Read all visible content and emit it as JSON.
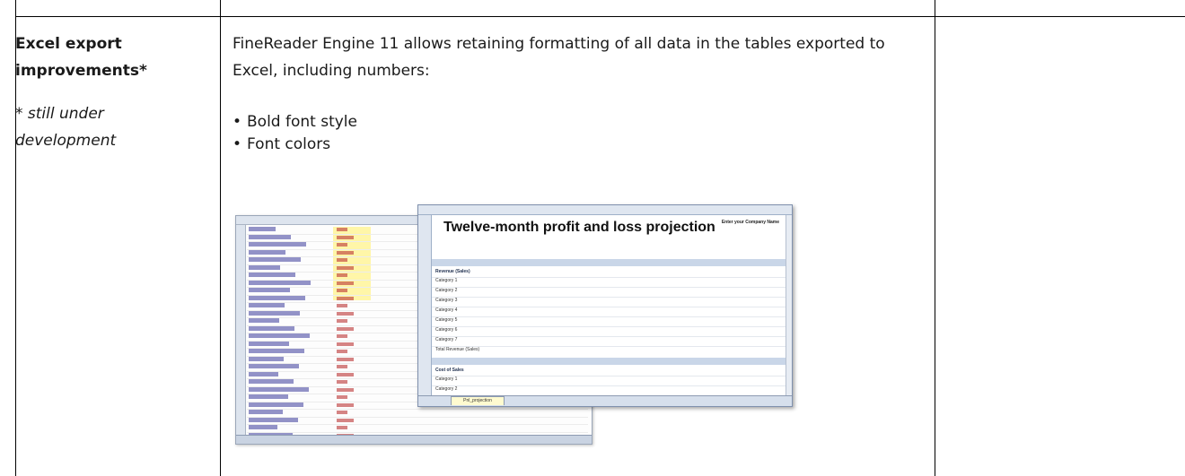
{
  "row": {
    "feature_title": "Excel export improvements*",
    "feature_note": "* still under development",
    "description": "FineReader Engine 11 allows retaining formatting of all data in the tables exported to Excel, including numbers:",
    "bullets": [
      "Bold font style",
      "Font colors"
    ]
  },
  "illustration": {
    "front_sheet_heading": "Twelve-month profit and loss projection",
    "front_sheet_company": "Enter your Company Name",
    "front_sheet_tab": "Pnl_projection",
    "section_revenue": "Revenue (Sales)",
    "section_cost": "Cost of Sales",
    "line_labels": [
      "Category 1",
      "Category 2",
      "Category 3",
      "Category 4",
      "Category 5",
      "Category 6",
      "Category 7",
      "Total Revenue (Sales)"
    ],
    "cost_labels": [
      "Category 1",
      "Category 2"
    ]
  },
  "colors": {
    "grid": "#000000",
    "header_fill": "#dfe6f0",
    "band_fill": "#c9d6e8",
    "highlight": "#fff6a8"
  }
}
